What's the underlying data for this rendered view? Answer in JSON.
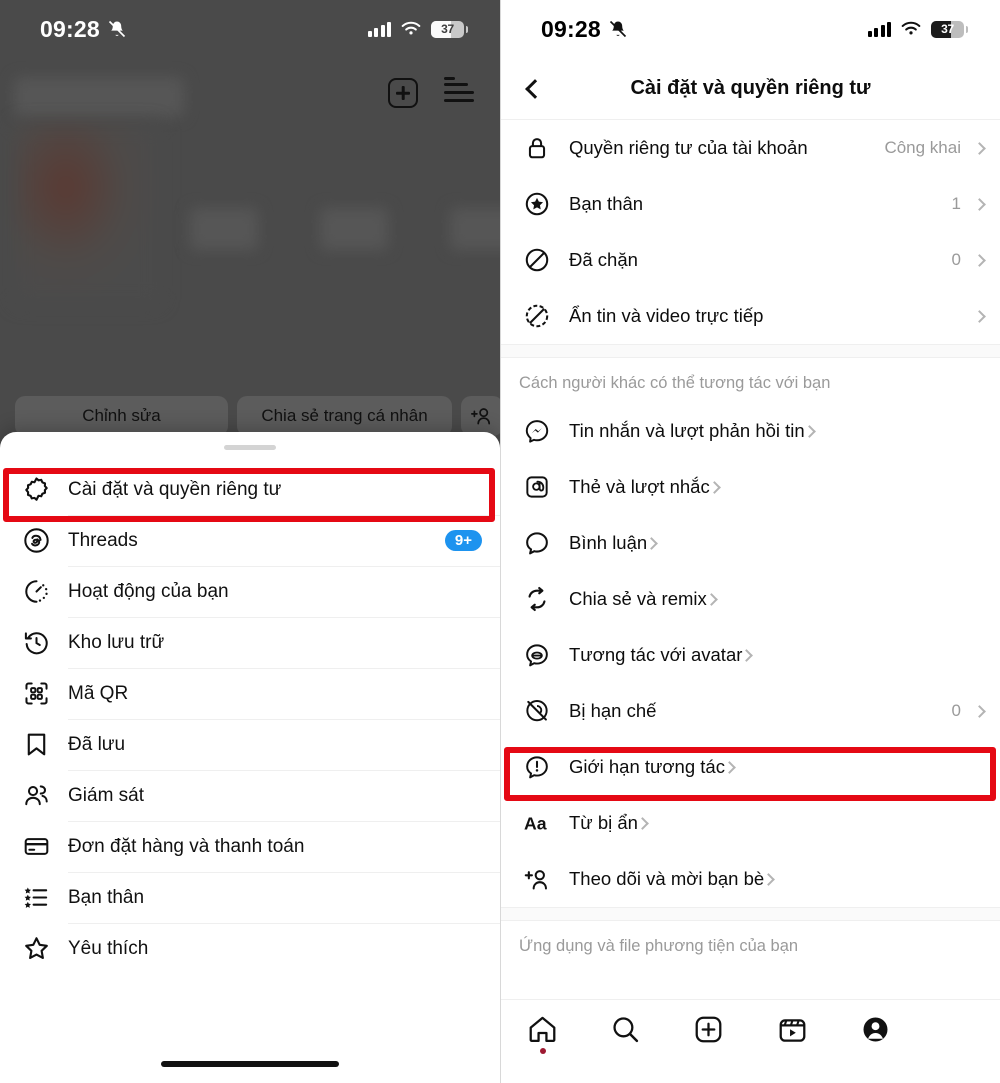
{
  "left_panel": {
    "statusbar": {
      "time": "09:28",
      "mute_icon": "bell-slash-icon",
      "battery_level": "37"
    },
    "header": {
      "add_icon": "plus-box-icon",
      "menu_icon": "hamburger-menu-icon"
    },
    "profile_buttons": {
      "edit": "Chỉnh sửa",
      "share": "Chia sẻ trang cá nhân",
      "add_person_icon": "add-person-icon"
    },
    "profile_tabs": [
      {
        "icon": "grid-icon"
      },
      {
        "icon": "reels-icon"
      },
      {
        "icon": "tagged-icon"
      }
    ],
    "sheet": {
      "items": [
        {
          "icon": "settings-gear-icon",
          "label": "Cài đặt và quyền riêng tư",
          "badge": "",
          "highlighted": true
        },
        {
          "icon": "threads-icon",
          "label": "Threads",
          "badge": "9+"
        },
        {
          "icon": "activity-clock-icon",
          "label": "Hoạt động của bạn",
          "badge": ""
        },
        {
          "icon": "archive-history-icon",
          "label": "Kho lưu trữ",
          "badge": ""
        },
        {
          "icon": "qr-code-icon",
          "label": "Mã QR",
          "badge": ""
        },
        {
          "icon": "bookmark-icon",
          "label": "Đã lưu",
          "badge": ""
        },
        {
          "icon": "supervision-people-icon",
          "label": "Giám sát",
          "badge": ""
        },
        {
          "icon": "credit-card-icon",
          "label": "Đơn đặt hàng và thanh toán",
          "badge": ""
        },
        {
          "icon": "close-friends-list-icon",
          "label": "Bạn thân",
          "badge": ""
        },
        {
          "icon": "star-icon",
          "label": "Yêu thích",
          "badge": ""
        }
      ]
    }
  },
  "right_panel": {
    "statusbar": {
      "time": "09:28",
      "mute_icon": "bell-slash-icon",
      "battery_level": "37"
    },
    "header": {
      "back_icon": "chevron-left-icon",
      "title": "Cài đặt và quyền riêng tư"
    },
    "group_1": [
      {
        "icon": "lock-icon",
        "label": "Quyền riêng tư của tài khoản",
        "value": "Công khai"
      },
      {
        "icon": "star-circle-icon",
        "label": "Bạn thân",
        "value": "1"
      },
      {
        "icon": "block-icon",
        "label": "Đã chặn",
        "value": "0"
      },
      {
        "icon": "hide-story-icon",
        "label": "Ẩn tin và video trực tiếp",
        "value": ""
      }
    ],
    "section_2_title": "Cách người khác có thể tương tác với bạn",
    "group_2": [
      {
        "icon": "messenger-icon",
        "label": "Tin nhắn và lượt phản hồi tin",
        "value": ""
      },
      {
        "icon": "mention-at-icon",
        "label": "Thẻ và lượt nhắc",
        "value": ""
      },
      {
        "icon": "comment-bubble-icon",
        "label": "Bình luận",
        "value": ""
      },
      {
        "icon": "share-remix-icon",
        "label": "Chia sẻ và remix",
        "value": ""
      },
      {
        "icon": "avatar-chat-icon",
        "label": "Tương tác với avatar",
        "value": ""
      },
      {
        "icon": "restricted-icon",
        "label": "Bị hạn chế",
        "value": "0"
      },
      {
        "icon": "interaction-limit-icon",
        "label": "Giới hạn tương tác",
        "value": "",
        "highlighted": true
      },
      {
        "icon": "hidden-words-icon",
        "label": "Từ bị ẩn",
        "value": ""
      },
      {
        "icon": "follow-invite-icon",
        "label": "Theo dõi và mời bạn bè",
        "value": ""
      }
    ],
    "section_3_title": "Ứng dụng và file phương tiện của bạn",
    "tabbar": [
      {
        "icon": "home-icon",
        "active": true
      },
      {
        "icon": "search-icon",
        "active": false
      },
      {
        "icon": "create-plus-icon",
        "active": false
      },
      {
        "icon": "reels-icon",
        "active": false
      },
      {
        "icon": "profile-avatar-icon",
        "active": false
      }
    ]
  },
  "colors": {
    "highlight_red": "#e50914",
    "badge_blue": "#1d93ef",
    "notification_dot": "#9e1a32",
    "overlay_dark": "#4a4a4a"
  }
}
